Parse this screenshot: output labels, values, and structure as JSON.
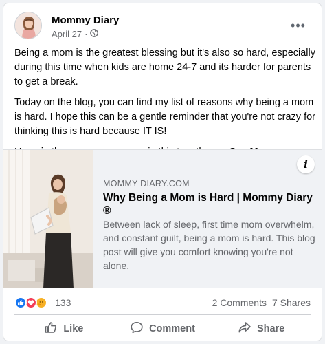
{
  "post": {
    "page_name": "Mommy Diary",
    "date": "April 27",
    "audience_icon": "globe-icon",
    "more_icon": "more-options-icon",
    "more_glyph": "•••",
    "paragraphs": [
      "Being a mom is the greatest blessing but it's also so hard, especially during this time when kids are home 24-7 and its harder for parents to get a break.",
      "Today on the blog, you can find my list of reasons why being a mom is hard. I hope this can be a gentle reminder that you're not crazy for thinking this is hard because IT IS!",
      "Hang in there mamas, we are in this together. ..."
    ],
    "see_more": "See More"
  },
  "link": {
    "domain": "MOMMY-DIARY.COM",
    "title": "Why Being a Mom is Hard | Mommy Diary ®",
    "description": "Between lack of sleep, first time mom overwhelm, and constant guilt, being a mom is hard. This blog post will give you comfort knowing you're not alone.",
    "info_glyph": "i"
  },
  "stats": {
    "reaction_count": "133",
    "comments": "2 Comments",
    "shares": "7 Shares",
    "reactions": [
      "like",
      "love",
      "care"
    ]
  },
  "actions": {
    "like": "Like",
    "comment": "Comment",
    "share": "Share"
  },
  "colors": {
    "like_blue": "#1877f2",
    "love_red": "#f33e58",
    "care_yellow": "#f7b125",
    "secondary_text": "#65676b"
  }
}
